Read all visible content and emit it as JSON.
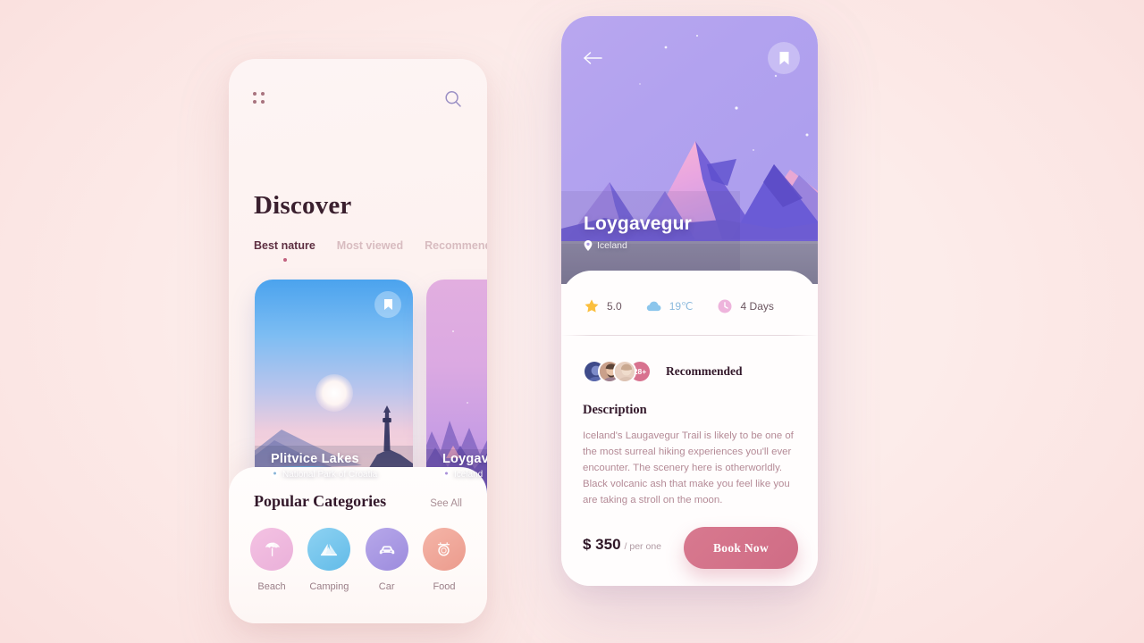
{
  "theme": {
    "page_bg": "#fceceb",
    "accent_pink": "#cf6c85",
    "heading_color": "#33182a",
    "muted_text": "#b48a96"
  },
  "discover_screen": {
    "menu_icon": "grid-dots-icon",
    "search_icon": "search-icon",
    "title": "Discover",
    "tabs": [
      {
        "label": "Best nature",
        "active": true
      },
      {
        "label": "Most viewed",
        "active": false
      },
      {
        "label": "Recommended",
        "active": false
      }
    ],
    "cards": [
      {
        "name": "Plitvice Lakes",
        "location": "National Park of Croatia",
        "bookmark_icon": "bookmark-icon",
        "pin_icon": "location-pin-icon"
      },
      {
        "name": "Loygavegur",
        "location": "Iceland",
        "pin_icon": "location-pin-icon"
      }
    ],
    "categories_section": {
      "title": "Popular Categories",
      "see_all_label": "See All",
      "items": [
        {
          "label": "Beach",
          "icon": "beach-umbrella-icon",
          "color": "#efb4da"
        },
        {
          "label": "Camping",
          "icon": "tent-icon",
          "color": "#71c3ea"
        },
        {
          "label": "Car",
          "icon": "car-icon",
          "color": "#a99ae0"
        },
        {
          "label": "Food",
          "icon": "food-dish-icon",
          "color": "#f0a79b"
        }
      ]
    }
  },
  "detail_screen": {
    "back_icon": "arrow-left-icon",
    "bookmark_icon": "bookmark-icon",
    "hero": {
      "name": "Loygavegur",
      "location": "Iceland",
      "pin_icon": "location-pin-icon"
    },
    "stats": [
      {
        "icon": "star-icon",
        "value": "5.0"
      },
      {
        "icon": "cloud-icon",
        "value": "19℃"
      },
      {
        "icon": "clock-icon",
        "value": "4 Days"
      }
    ],
    "recommended": {
      "label": "Recommended",
      "avatar_count_badge": "28+"
    },
    "description_title": "Description",
    "description_text": "Iceland's Laugavegur Trail is likely to be one of the most surreal hiking experiences you'll ever encounter. The scenery here is otherworldly. Black volcanic ash that make you feel like you are taking a stroll on the moon.",
    "price": {
      "amount": "$ 350",
      "unit": "/ per one"
    },
    "book_button_label": "Book Now"
  }
}
